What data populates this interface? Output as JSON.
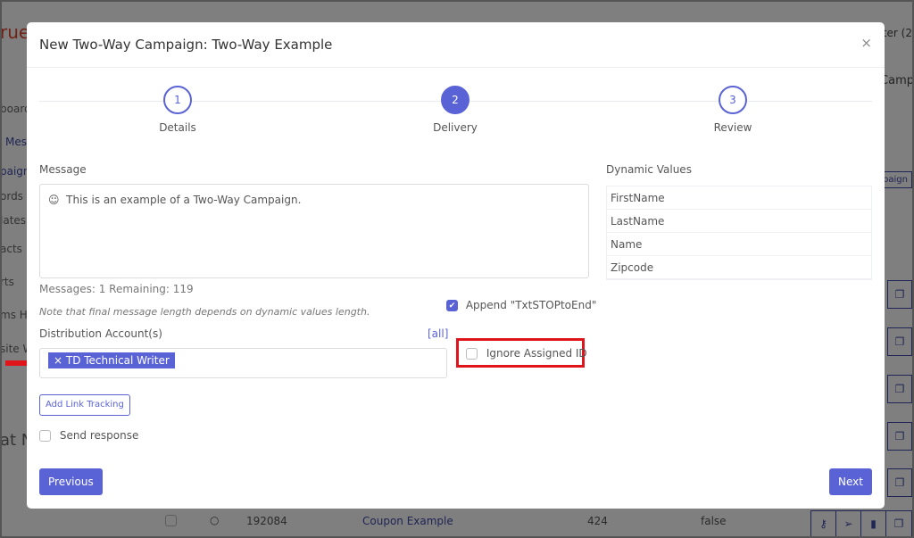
{
  "background": {
    "logo_fragment": "rue",
    "user_fragment": "ter (2",
    "sidebar": [
      "board",
      "Mes",
      "paigns",
      "ords",
      "lates",
      "acts",
      "rts",
      "ms H",
      "site W"
    ],
    "section_fragment": "at N",
    "header_fragment": "Camp",
    "new_button_fragment": "paign",
    "row": {
      "id": "192084",
      "name": "Coupon Example",
      "count": "424",
      "flag": "false"
    }
  },
  "modal": {
    "title": "New Two-Way Campaign: Two-Way Example",
    "close": "×",
    "steps": [
      {
        "num": "1",
        "label": "Details"
      },
      {
        "num": "2",
        "label": "Delivery"
      },
      {
        "num": "3",
        "label": "Review"
      }
    ],
    "active_step": 2,
    "message_label": "Message",
    "message_text": "This is an example of a Two-Way Campaign.",
    "counts": "Messages: 1 Remaining: 119",
    "note": "Note that final message length depends on dynamic values length.",
    "append_label": "Append \"TxtSTOPtoEnd\"",
    "append_checked": true,
    "distribution_label": "Distribution Account(s)",
    "all_link": "[all]",
    "selected_account": "× TD Technical Writer",
    "ignore_label": "Ignore Assigned ID",
    "ignore_checked": false,
    "link_tracking": "Add Link Tracking",
    "send_response": "Send response",
    "send_response_checked": false,
    "dynamic_label": "Dynamic Values",
    "dynamic_values": [
      "FirstName",
      "LastName",
      "Name",
      "Zipcode"
    ],
    "previous": "Previous",
    "next": "Next"
  },
  "colors": {
    "accent": "#5a63d6",
    "highlight": "#e0151b"
  }
}
